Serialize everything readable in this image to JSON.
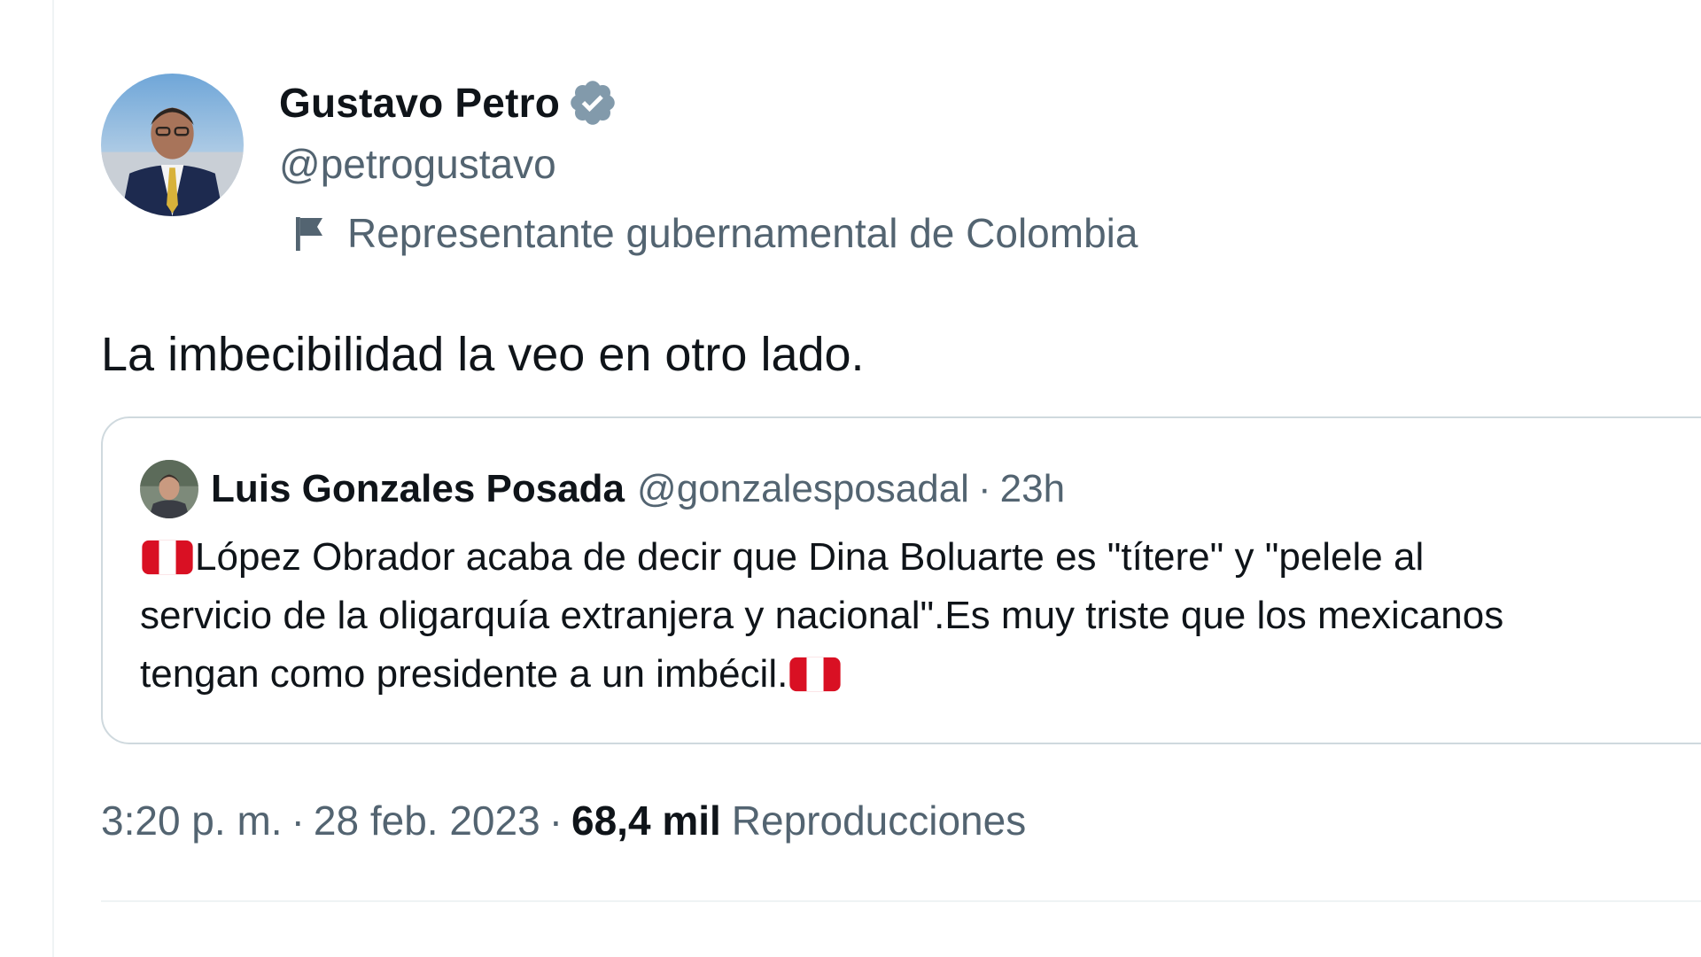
{
  "tweet": {
    "author": {
      "display_name": "Gustavo Petro",
      "handle": "@petrogustavo",
      "verified_icon": "verified-badge-icon",
      "affiliation_icon": "flag-icon",
      "affiliation": "Representante gubernamental de Colombia"
    },
    "text": "La imbecibilidad la veo en otro lado.",
    "quote": {
      "author_name": "Luis Gonzales Posada",
      "author_handle": "@gonzalesposadal",
      "separator": "·",
      "time": "23h",
      "lines": [
        "López Obrador acaba de decir que Dina Boluarte es \"títere\" y \"pelele al",
        "servicio de la oligarquía extranjera y nacional\".Es muy triste que los mexicanos",
        "tengan como presidente a un imbécil."
      ],
      "emoji": "peru-flag-emoji"
    },
    "meta": {
      "time": "3:20 p. m.",
      "separator": "·",
      "date": "28 feb. 2023",
      "views_count": "68,4 mil",
      "views_label": "Reproducciones"
    }
  },
  "colors": {
    "primary_text": "#0f1419",
    "secondary_text": "#536471",
    "border": "#cfd9de",
    "verified": "#829aab",
    "peru_red": "#d91023"
  }
}
